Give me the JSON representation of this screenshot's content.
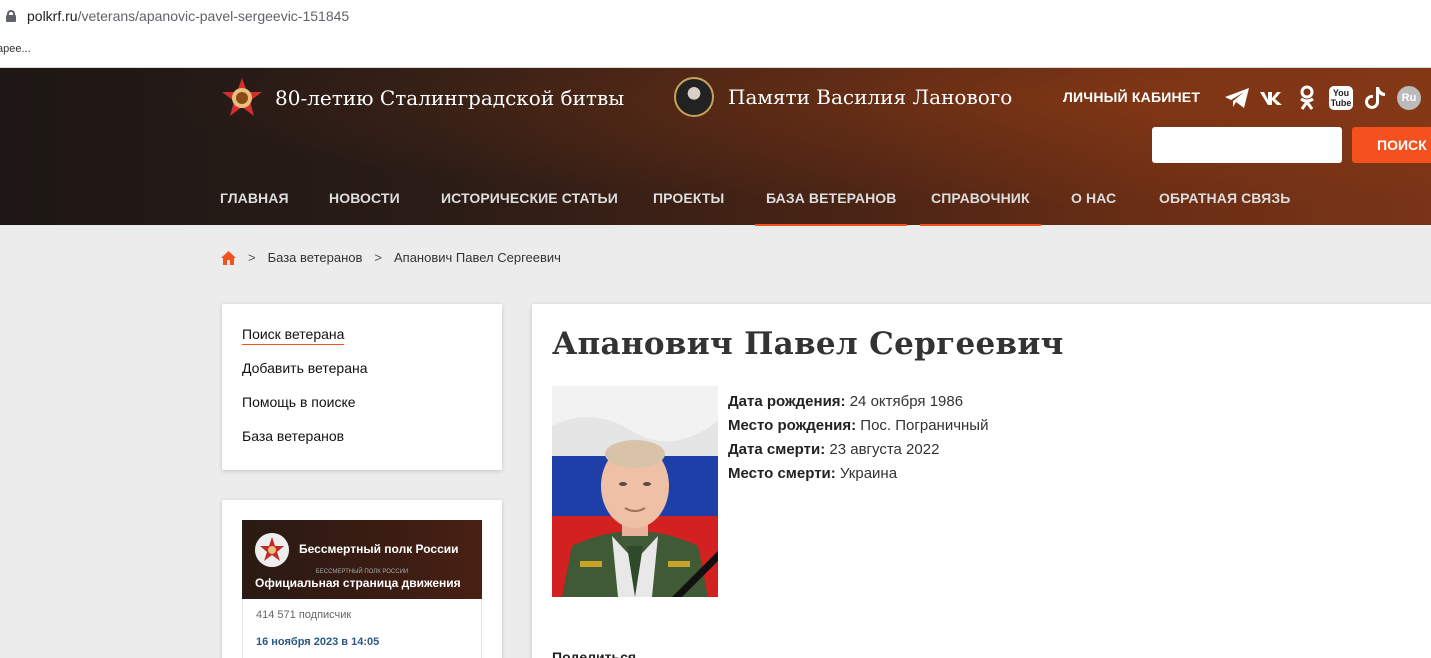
{
  "browser": {
    "url_host": "polkrf.ru",
    "url_path": "/veterans/apanovic-pavel-sergeevic-151845",
    "bookmark_fragment": "арее..."
  },
  "header": {
    "promo1": "80-летию Сталинградской битвы",
    "promo2": "Памяти Василия Ланового",
    "cabinet": "ЛИЧНЫЙ КАБИНЕТ",
    "socials": [
      "telegram-icon",
      "vk-icon",
      "odnoklassniki-icon",
      "youtube-icon",
      "tiktok-icon",
      "rutube-icon"
    ],
    "youtube_top": "You",
    "youtube_bottom": "Tube",
    "rutube_label": "Ru",
    "search_placeholder": "",
    "search_button": "ПОИСК"
  },
  "nav": {
    "items": [
      {
        "label": "ГЛАВНАЯ"
      },
      {
        "label": "НОВОСТИ"
      },
      {
        "label": "ИСТОРИЧЕСКИЕ СТАТЬИ"
      },
      {
        "label": "ПРОЕКТЫ"
      },
      {
        "label": "БАЗА ВЕТЕРАНОВ"
      },
      {
        "label": "СПРАВОЧНИК"
      },
      {
        "label": "О НАС"
      },
      {
        "label": "ОБРАТНАЯ СВЯЗЬ"
      }
    ]
  },
  "breadcrumb": {
    "sep": ">",
    "level1": "База ветеранов",
    "level2": "Апанович Павел Сергеевич"
  },
  "sidebar": {
    "items": [
      {
        "label": "Поиск ветерана"
      },
      {
        "label": "Добавить ветерана"
      },
      {
        "label": "Помощь в поиске"
      },
      {
        "label": "База ветеранов"
      }
    ]
  },
  "widget": {
    "title": "Бессмертный полк России",
    "small": "БЕССМЕРТНЫЙ ПОЛК РОССИИ",
    "subtitle": "Официальная страница движения",
    "subscribers": "414 571 подписчик",
    "post_date": "16 ноября 2023 в 14:05"
  },
  "veteran": {
    "name": "Апанович Павел Сергеевич",
    "birth_label": "Дата рождения:",
    "birth_value": "24 октября 1986",
    "birthplace_label": "Место рождения:",
    "birthplace_value": "Пос. Пограничный",
    "death_label": "Дата смерти:",
    "death_value": "23 августа 2022",
    "deathplace_label": "Место смерти:",
    "deathplace_value": "Украина",
    "share": "Поделиться"
  },
  "colors": {
    "accent": "#f4511e",
    "header_dark": "#1d1715",
    "header_warm": "#7a3417",
    "link_blue": "#2a5885"
  }
}
